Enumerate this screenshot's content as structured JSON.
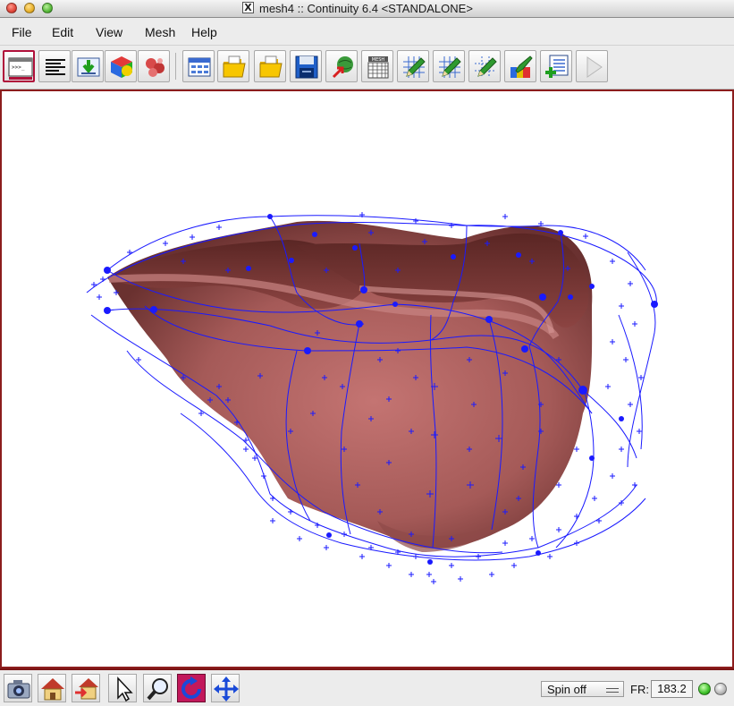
{
  "window": {
    "title": "mesh4 :: Continuity 6.4 <STANDALONE>"
  },
  "menu": {
    "items": [
      "File",
      "Edit",
      "View",
      "Mesh",
      "Help"
    ]
  },
  "toolbar": {
    "mesh_icon_label": "MESH",
    "buttons": [
      "console-icon",
      "text-document-icon",
      "download-icon",
      "color-cube-icon",
      "molecule-icon",
      "table-icon",
      "open-folder-icon",
      "open-folder-alt-icon",
      "save-disk-icon",
      "network-globe-icon",
      "mesh-grid-icon",
      "pencil-grid-icon",
      "pencil-grid-alt-icon",
      "pencil-grid-edit-icon",
      "paint-brush-icon",
      "add-list-icon",
      "play-icon"
    ]
  },
  "viewport": {
    "mesh_color": "#b86462",
    "wire_color": "#1a1aff",
    "border_color": "#8c1d1d"
  },
  "bottombar": {
    "spin_selected": "Spin off",
    "fr_label": "FR:",
    "fr_value": "183.2",
    "status_leds": [
      "green",
      "gray"
    ]
  }
}
